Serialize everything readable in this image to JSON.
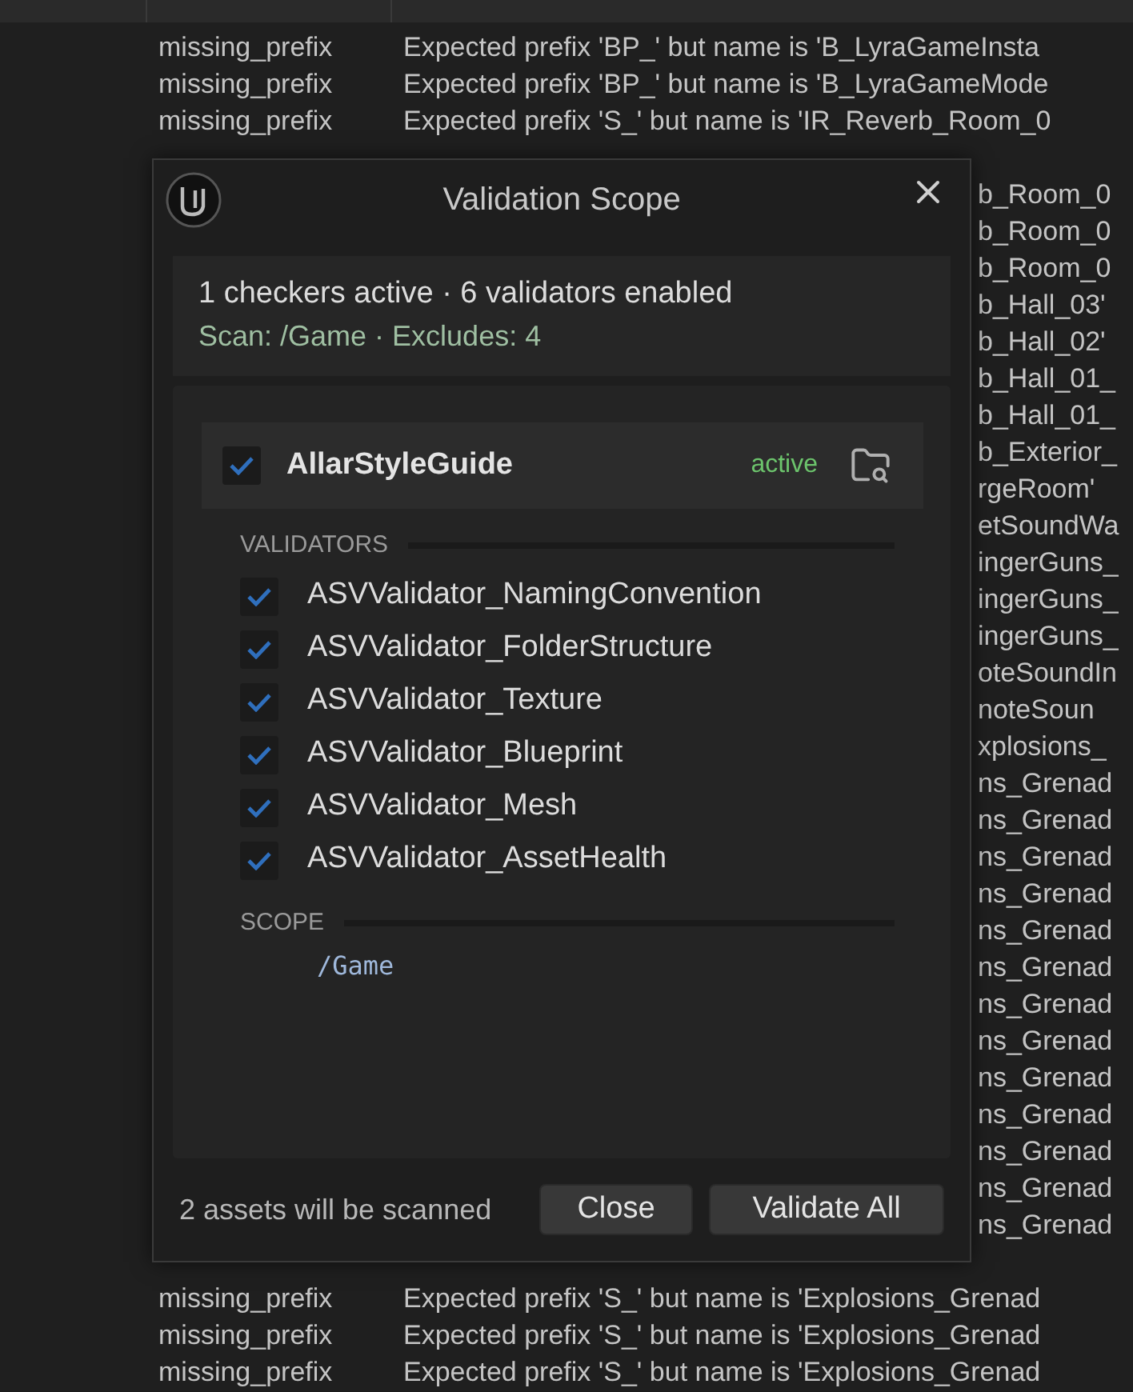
{
  "table": {
    "top_rows": [
      {
        "rule": "missing_prefix",
        "problem": "Expected prefix 'BP_' but name is 'B_LyraGameInsta"
      },
      {
        "rule": "missing_prefix",
        "problem": "Expected prefix 'BP_' but name is 'B_LyraGameMode"
      },
      {
        "rule": "missing_prefix",
        "problem": "Expected prefix 'S_' but name is 'IR_Reverb_Room_0"
      }
    ],
    "right_fragments": [
      "b_Room_0",
      "b_Room_0",
      "b_Room_0",
      "b_Hall_03'",
      "b_Hall_02'",
      "b_Hall_01_",
      "b_Hall_01_",
      "b_Exterior_",
      "rgeRoom'",
      "etSoundWa",
      "ingerGuns_",
      "ingerGuns_",
      "ingerGuns_",
      "oteSoundIn",
      "noteSoun",
      "xplosions_",
      "ns_Grenad",
      "ns_Grenad",
      "ns_Grenad",
      "ns_Grenad",
      "ns_Grenad",
      "ns_Grenad",
      "ns_Grenad",
      "ns_Grenad",
      "ns_Grenad",
      "ns_Grenad",
      "ns_Grenad",
      "ns_Grenad",
      "ns_Grenad"
    ],
    "bottom_rows": [
      {
        "rule": "missing_prefix",
        "problem": "Expected prefix 'S_' but name is 'Explosions_Grenad"
      },
      {
        "rule": "missing_prefix",
        "problem": "Expected prefix 'S_' but name is 'Explosions_Grenad"
      },
      {
        "rule": "missing_prefix",
        "problem": "Expected prefix 'S_' but name is 'Explosions_Grenad"
      }
    ]
  },
  "dialog": {
    "title": "Validation Scope",
    "summary": {
      "line_1": "1 checkers active  ·  6 validators enabled",
      "line_2": "Scan: /Game  ·  Excludes: 4"
    },
    "checkers": [
      {
        "name": "AllarStyleGuide",
        "checked": true,
        "status": "active"
      }
    ],
    "validators_heading": "VALIDATORS",
    "validators": [
      {
        "label": "ASVValidator_NamingConvention",
        "checked": true
      },
      {
        "label": "ASVValidator_FolderStructure",
        "checked": true
      },
      {
        "label": "ASVValidator_Texture",
        "checked": true
      },
      {
        "label": "ASVValidator_Blueprint",
        "checked": true
      },
      {
        "label": "ASVValidator_Mesh",
        "checked": true
      },
      {
        "label": "ASVValidator_AssetHealth",
        "checked": true
      }
    ],
    "scope_heading": "SCOPE",
    "scope_paths": [
      "/Game"
    ],
    "footer_text": "2 assets will be scanned",
    "buttons": [
      "Close",
      "Validate All"
    ]
  }
}
